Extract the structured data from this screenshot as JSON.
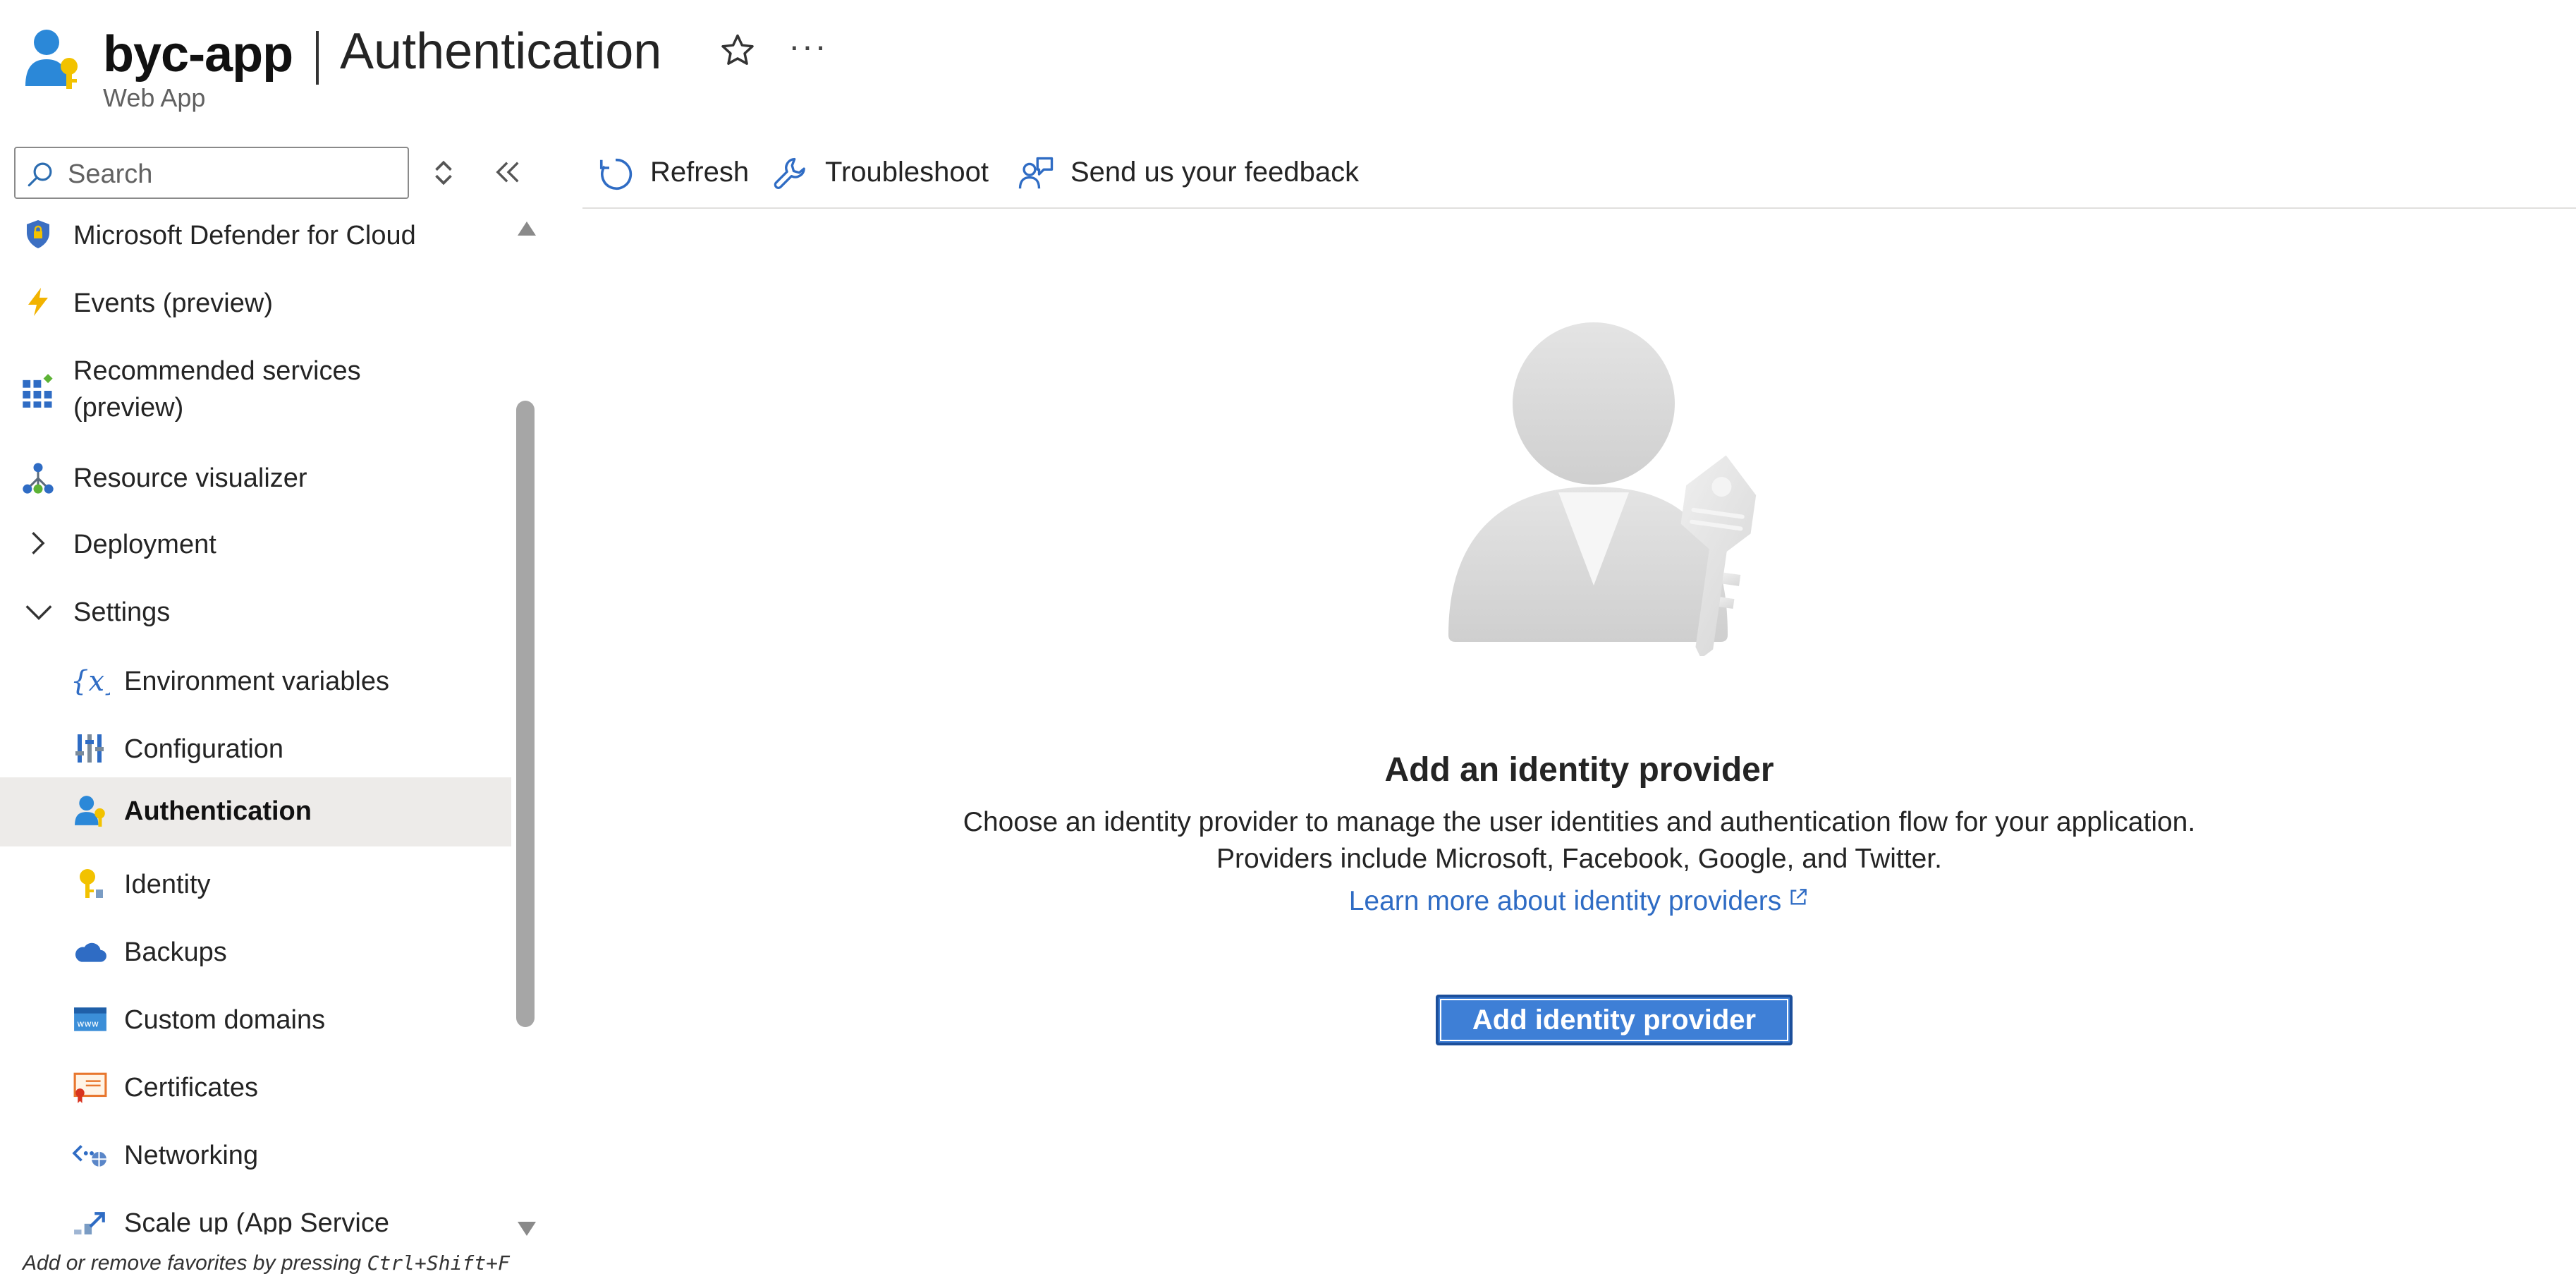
{
  "header": {
    "app_name": "byc-app",
    "page_title": "Authentication",
    "subtitle": "Web App",
    "more_label": "···"
  },
  "sidebar": {
    "search_placeholder": "Search",
    "items": [
      {
        "label": "Microsoft Defender for Cloud",
        "icon": "shield-icon"
      },
      {
        "label": "Events (preview)",
        "icon": "lightning-icon"
      },
      {
        "label": "Recommended services",
        "label2": "(preview)",
        "icon": "grid-icon"
      },
      {
        "label": "Resource visualizer",
        "icon": "tree-icon"
      },
      {
        "label": "Deployment",
        "icon": "chevron-right-icon"
      },
      {
        "label": "Settings",
        "icon": "chevron-down-icon"
      },
      {
        "label": "Environment variables",
        "icon": "variable-icon"
      },
      {
        "label": "Configuration",
        "icon": "sliders-icon"
      },
      {
        "label": "Authentication",
        "icon": "user-key-icon",
        "selected": true
      },
      {
        "label": "Identity",
        "icon": "key-icon"
      },
      {
        "label": "Backups",
        "icon": "cloud-icon"
      },
      {
        "label": "Custom domains",
        "icon": "www-icon"
      },
      {
        "label": "Certificates",
        "icon": "certificate-icon"
      },
      {
        "label": "Networking",
        "icon": "network-icon"
      },
      {
        "label": "Scale up (App Service",
        "icon": "scale-icon"
      }
    ],
    "favorites_hint_prefix": "Add or remove favorites by pressing ",
    "favorites_hint_keys": "Ctrl+Shift+F"
  },
  "toolbar": {
    "refresh_label": "Refresh",
    "troubleshoot_label": "Troubleshoot",
    "feedback_label": "Send us your feedback"
  },
  "main": {
    "title": "Add an identity provider",
    "desc_line1": "Choose an identity provider to manage the user identities and authentication flow for your application.",
    "desc_line2": "Providers include Microsoft, Facebook, Google, and Twitter.",
    "learn_more": "Learn more about identity providers",
    "add_button": "Add identity provider"
  },
  "colors": {
    "accent": "#3e7fd6",
    "link": "#2f6cc4",
    "selected_bg": "#edebe9"
  }
}
